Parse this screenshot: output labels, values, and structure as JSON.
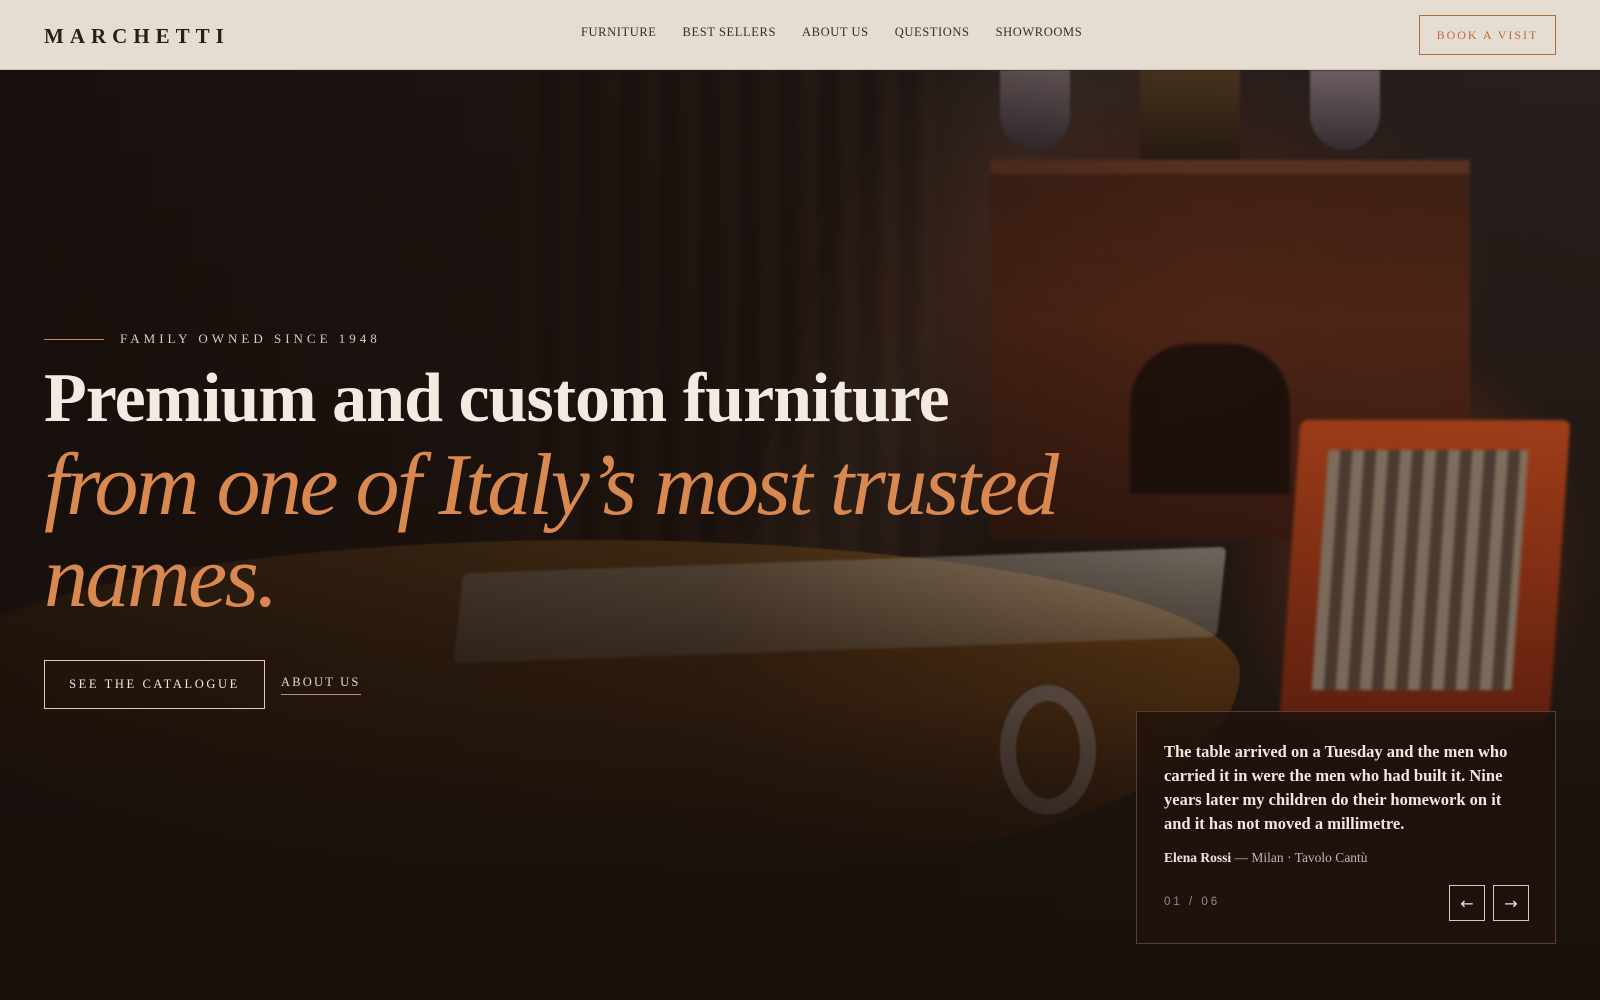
{
  "brand": {
    "name": "MARCHETTI"
  },
  "nav": {
    "items": [
      {
        "label": "FURNITURE"
      },
      {
        "label": "BEST SELLERS"
      },
      {
        "label": "ABOUT US"
      },
      {
        "label": "QUESTIONS"
      },
      {
        "label": "SHOWROOMS"
      }
    ],
    "book_label": "BOOK A VISIT"
  },
  "hero": {
    "eyebrow": "FAMILY OWNED SINCE 1948",
    "headline_line1": "Premium and custom furniture",
    "headline_line2": "from one of Italy’s most trusted names.",
    "cta_primary": "SEE THE CATALOGUE",
    "cta_secondary": "ABOUT US"
  },
  "testimonial": {
    "quote": "The table arrived on a Tuesday and the men who carried it in were the men who had built it. Nine years later my children do their homework on it and it has not moved a millimetre.",
    "author": "Elena Rossi",
    "detail": "— Milan · Tavolo Cantù",
    "counter": "01 / 06",
    "prev_icon": "arrow-left-icon",
    "next_icon": "arrow-right-icon"
  },
  "colors": {
    "accent": "#d9894f",
    "header_bg": "#e6ddd2",
    "dark_bg": "#1a110c",
    "button_border": "#b86b3c"
  }
}
